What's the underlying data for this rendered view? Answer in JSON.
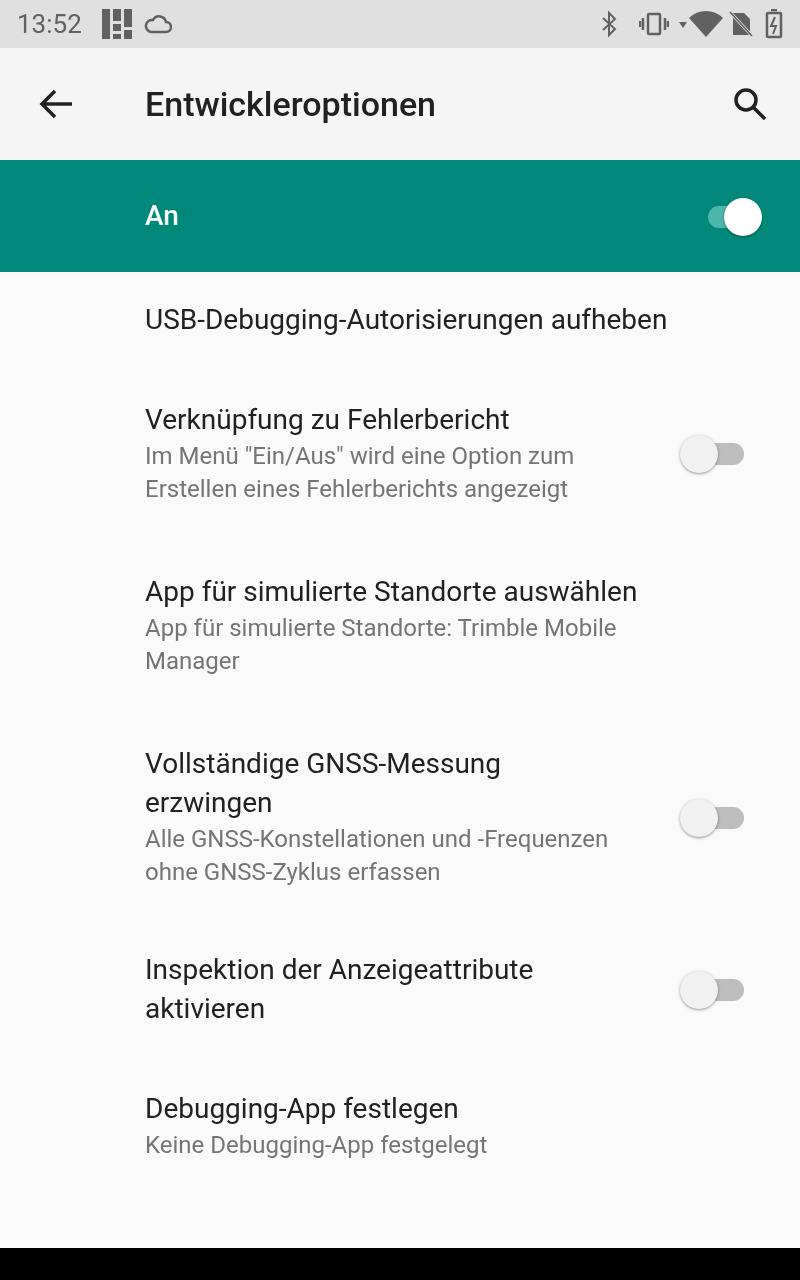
{
  "status_bar": {
    "time": "13:52"
  },
  "toolbar": {
    "title": "Entwickleroptionen"
  },
  "master_switch": {
    "label": "An",
    "on": true
  },
  "settings": [
    {
      "kind": "action",
      "title": "USB-Debugging-Autorisierungen aufheben"
    },
    {
      "kind": "switch",
      "title": "Verknüpfung zu Fehlerbericht",
      "summary": "Im Menü \"Ein/Aus\" wird eine Option zum Erstellen eines Fehlerberichts angezeigt",
      "on": false
    },
    {
      "kind": "action",
      "title": "App für simulierte Standorte auswählen",
      "summary": "App für simulierte Standorte: Trimble Mobile Manager"
    },
    {
      "kind": "switch",
      "title": "Vollständige GNSS-Messung erzwingen",
      "summary": "Alle GNSS-Konstellationen und -Frequenzen ohne GNSS-Zyklus erfassen",
      "on": false
    },
    {
      "kind": "switch",
      "title": "Inspektion der Anzeigeattribute aktivieren",
      "on": false
    },
    {
      "kind": "action",
      "title": "Debugging-App festlegen",
      "summary": "Keine Debugging-App festgelegt"
    }
  ]
}
